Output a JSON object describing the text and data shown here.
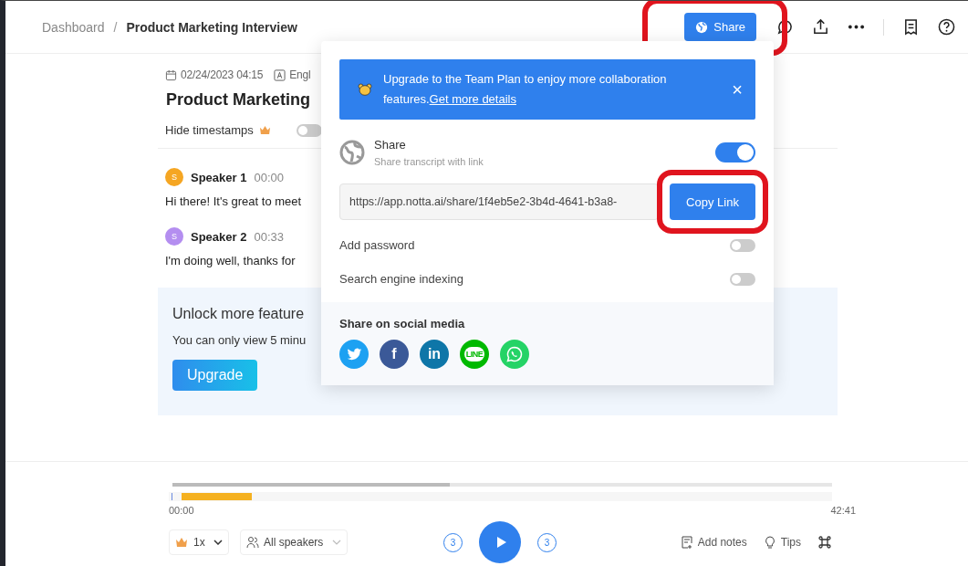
{
  "breadcrumb": {
    "parent": "Dashboard",
    "separator": "/",
    "current": "Product Marketing Interview"
  },
  "share_button": {
    "label": "Share",
    "highlighted": true
  },
  "meta": {
    "date": "02/24/2023 04:15",
    "language": "Engl"
  },
  "title": "Product Marketing",
  "hide_timestamps": {
    "label": "Hide timestamps",
    "on": false
  },
  "transcript": [
    {
      "initial": "S",
      "speaker": "Speaker 1",
      "time": "00:00",
      "text": "Hi there! It's great to meet",
      "color": "#f5a623"
    },
    {
      "initial": "S",
      "speaker": "Speaker 2",
      "time": "00:33",
      "text": "I'm doing well, thanks for",
      "color": "#b48ef0"
    }
  ],
  "unlock_panel": {
    "heading": "Unlock more feature",
    "text": "You can only view 5 minu",
    "button": "Upgrade"
  },
  "share_popover": {
    "banner": {
      "text": "Upgrade to the Team Plan to enjoy more collaboration features.",
      "link": "Get more details",
      "close": "×"
    },
    "share": {
      "title": "Share",
      "subtitle": "Share transcript with link",
      "on": true
    },
    "link": {
      "value": "https://app.notta.ai/share/1f4eb5e2-3b4d-4641-b3a8-",
      "button": "Copy Link",
      "highlighted": true
    },
    "options": [
      {
        "label": "Add password",
        "on": false
      },
      {
        "label": "Search engine indexing",
        "on": false
      }
    ],
    "social_heading": "Share on social media",
    "social": [
      {
        "kind": "twitter"
      },
      {
        "kind": "facebook",
        "label": "f"
      },
      {
        "kind": "linkedin",
        "label": "in"
      },
      {
        "kind": "line",
        "label": "LINE"
      },
      {
        "kind": "whatsapp"
      }
    ]
  },
  "player": {
    "level": 0.42,
    "start": "00:00",
    "end": "42:41",
    "speed": "1x",
    "speakers": "All speakers",
    "rewind": "3",
    "forward": "3",
    "add_notes": "Add notes",
    "tips": "Tips"
  }
}
